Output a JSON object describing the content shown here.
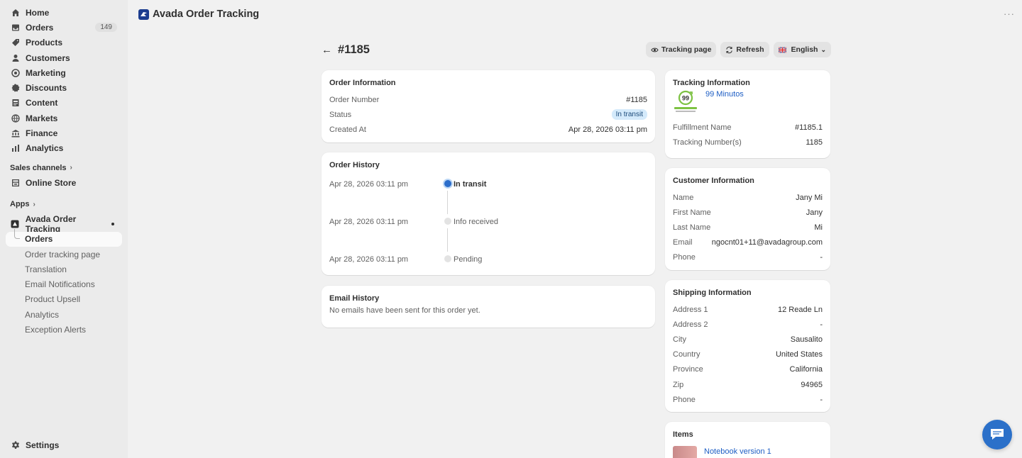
{
  "sidebar": {
    "items": [
      {
        "label": "Home",
        "icon": "home-icon"
      },
      {
        "label": "Orders",
        "icon": "inbox-icon",
        "badge": "149"
      },
      {
        "label": "Products",
        "icon": "tag-icon"
      },
      {
        "label": "Customers",
        "icon": "person-icon"
      },
      {
        "label": "Marketing",
        "icon": "target-icon"
      },
      {
        "label": "Discounts",
        "icon": "discount-icon"
      },
      {
        "label": "Content",
        "icon": "content-icon"
      },
      {
        "label": "Markets",
        "icon": "globe-icon"
      },
      {
        "label": "Finance",
        "icon": "bank-icon"
      },
      {
        "label": "Analytics",
        "icon": "bar-chart-icon"
      }
    ],
    "sales_channels_label": "Sales channels",
    "online_store_label": "Online Store",
    "apps_label": "Apps",
    "app_name": "Avada Order Tracking",
    "app_subitems": [
      "Orders",
      "Order tracking page",
      "Translation",
      "Email Notifications",
      "Product Upsell",
      "Analytics",
      "Exception Alerts"
    ],
    "settings_label": "Settings"
  },
  "header": {
    "app_title": "Avada Order Tracking",
    "more": "···"
  },
  "page": {
    "order_title": "#1185",
    "tracking_page_btn": "Tracking page",
    "refresh_btn": "Refresh",
    "language_btn": "English"
  },
  "order_info": {
    "title": "Order Information",
    "order_number_label": "Order Number",
    "order_number": "#1185",
    "status_label": "Status",
    "status": "In transit",
    "created_label": "Created At",
    "created": "Apr 28, 2026 03:11 pm"
  },
  "order_history": {
    "title": "Order History",
    "events": [
      {
        "date": "Apr 28, 2026 03:11 pm",
        "label": "In transit"
      },
      {
        "date": "Apr 28, 2026 03:11 pm",
        "label": "Info received"
      },
      {
        "date": "Apr 28, 2026 03:11 pm",
        "label": "Pending"
      }
    ]
  },
  "email_history": {
    "title": "Email History",
    "empty_text": "No emails have been sent for this order yet."
  },
  "tracking_info": {
    "title": "Tracking Information",
    "carrier": "99 Minutos",
    "fulfillment_label": "Fulfillment Name",
    "fulfillment": "#1185.1",
    "tracking_label": "Tracking Number(s)",
    "tracking": "1185"
  },
  "customer_info": {
    "title": "Customer Information",
    "name_label": "Name",
    "name": "Jany Mi",
    "first_label": "First Name",
    "first": "Jany",
    "last_label": "Last Name",
    "last": "Mi",
    "email_label": "Email",
    "email": "ngocnt01+11@avadagroup.com",
    "phone_label": "Phone",
    "phone": "-"
  },
  "shipping_info": {
    "title": "Shipping Information",
    "addr1_label": "Address 1",
    "addr1": "12 Reade Ln",
    "addr2_label": "Address 2",
    "addr2": "-",
    "city_label": "City",
    "city": "Sausalito",
    "country_label": "Country",
    "country": "United States",
    "province_label": "Province",
    "province": "California",
    "zip_label": "Zip",
    "zip": "94965",
    "phone_label": "Phone",
    "phone": "-"
  },
  "items": {
    "title": "Items",
    "product": "Notebook version 1"
  },
  "colors": {
    "accent": "#2c6ecb",
    "link": "#1e5ec4",
    "badge_bg": "#d4eafb"
  }
}
